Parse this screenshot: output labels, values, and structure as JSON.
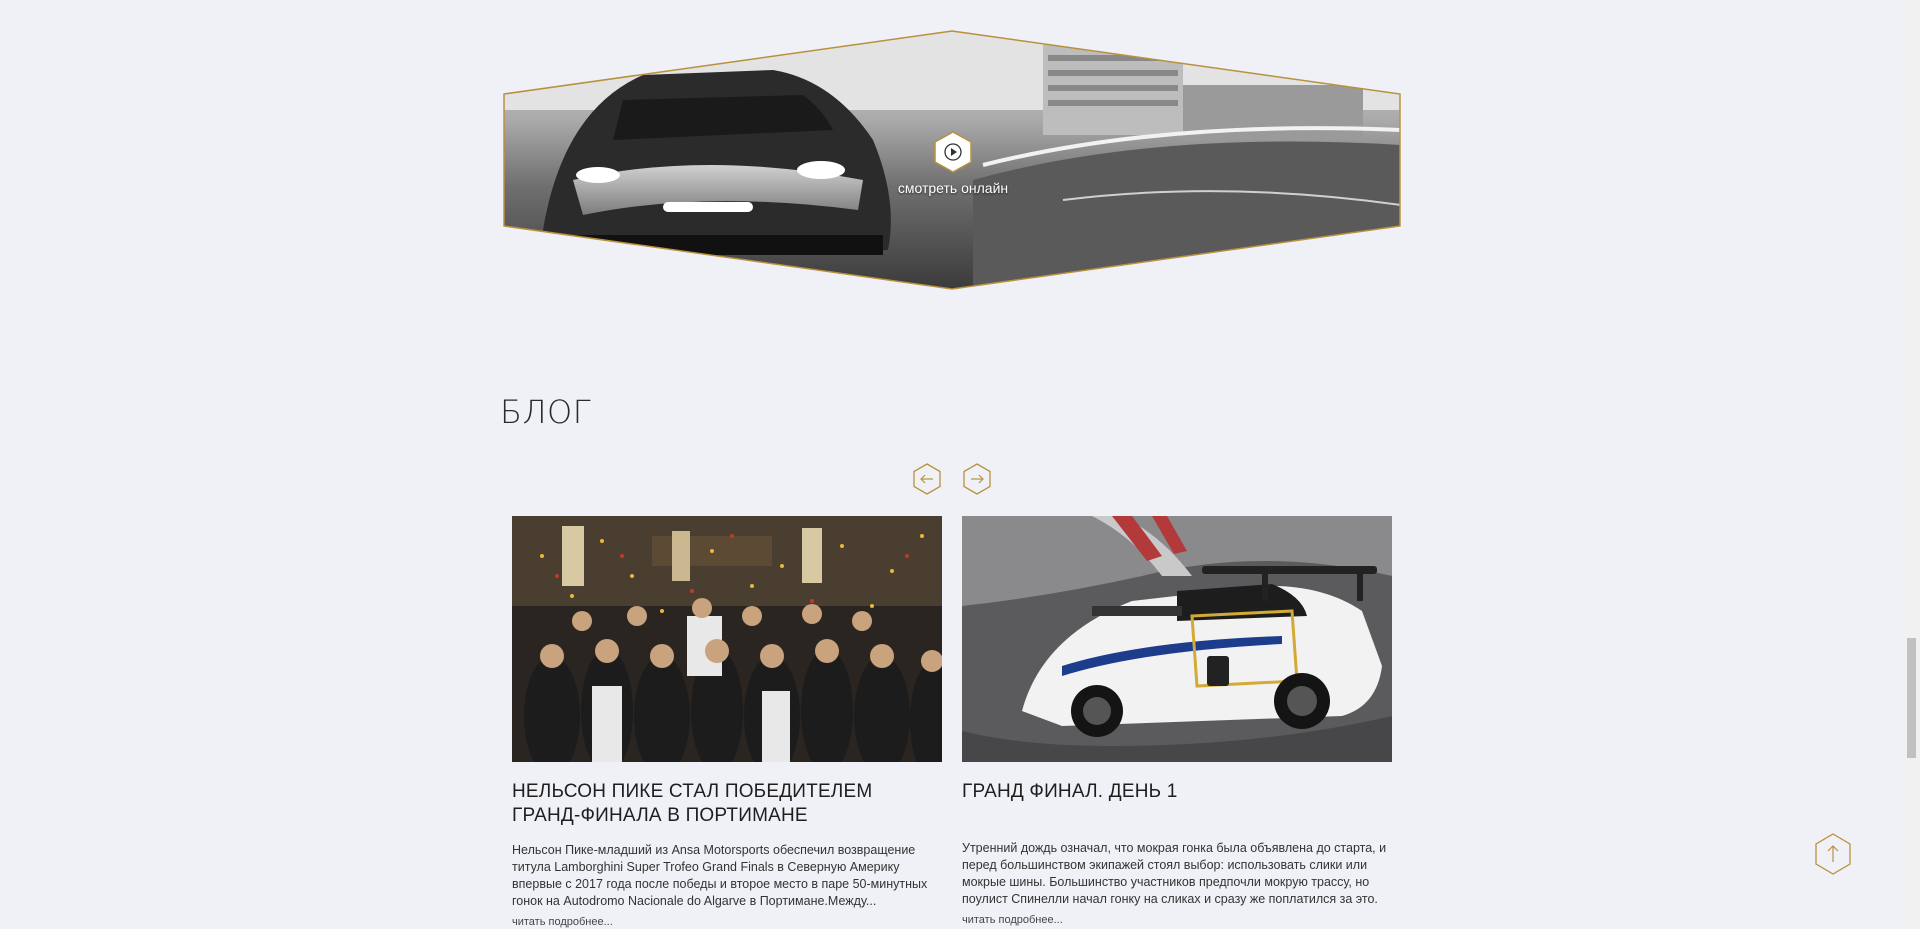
{
  "video": {
    "watch_label": "смотреть онлайн",
    "play_icon": "play-icon"
  },
  "blog": {
    "title": "БЛОГ",
    "prev_icon": "arrow-left-icon",
    "next_icon": "arrow-right-icon",
    "cards": [
      {
        "title": "НЕЛЬСОН ПИКЕ СТАЛ ПОБЕДИТЕЛЕМ ГРАНД-ФИНАЛА В ПОРТИМАНЕ",
        "text": "Нельсон Пике-младший из Ansa Motorsports обеспечил возвращение титула Lamborghini Super Trofeo Grand Finals в Северную Америку впервые с 2017 года после победы и второе место в паре 50-минутных гонок на Autodromo Nacionale do Algarve в Портимане.Между...",
        "read_more": "читать подробнее..."
      },
      {
        "title": "ГРАНД ФИНАЛ. ДЕНЬ 1",
        "text": "Утренний дождь означал, что мокрая гонка была объявлена до старта, и перед большинством экипажей стоял выбор: использовать слики или мокрые шины. Большинство участников предпочли мокрую трассу, но поулист Спинелли начал гонку на сликах и сразу же поплатился за это.",
        "read_more": "читать подробнее..."
      }
    ]
  },
  "to_top_icon": "arrow-up-icon",
  "colors": {
    "accent": "#b8913e",
    "background": "#f0f1f6",
    "text": "#222222"
  }
}
